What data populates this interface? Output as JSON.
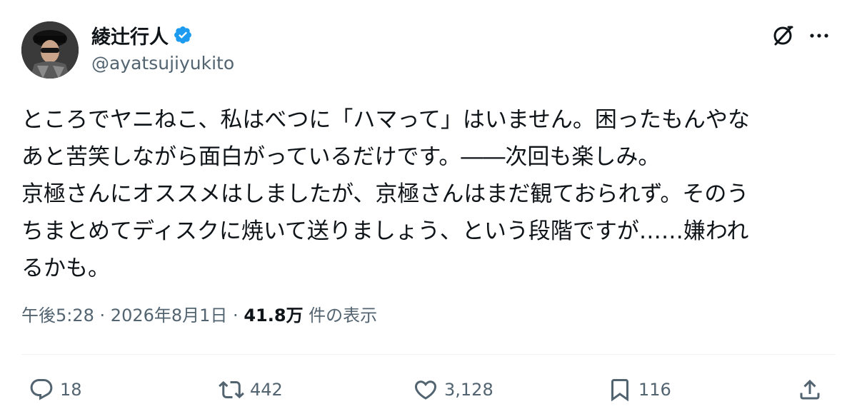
{
  "author": {
    "display_name": "綾辻行人",
    "handle": "@ayatsujiyukito",
    "verified_color": "#1d9bf0"
  },
  "tweet": {
    "lines": [
      "ところでヤニねこ、私はべつに「ハマって」はいません。困ったもんやな",
      "あと苦笑しながら面白がっているだけです。――次回も楽しみ。",
      "京極さんにオススメはしましたが、京極さんはまだ観ておられず。そのう",
      "ちまとめてディスクに焼いて送りましょう、という段階ですが……嫌われ",
      "るかも。"
    ]
  },
  "meta": {
    "time": "午後5:28",
    "separator": " · ",
    "date": "2026年8月1日",
    "views_count": "41.8万",
    "views_label": " 件の表示"
  },
  "actions": {
    "reply_count": "18",
    "retweet_count": "442",
    "like_count": "3,128",
    "bookmark_count": "116"
  },
  "icons": {
    "grok": "grok-icon",
    "more": "more-horizontal-icon",
    "reply": "reply-icon",
    "retweet": "retweet-icon",
    "like": "heart-icon",
    "bookmark": "bookmark-icon",
    "share": "share-icon"
  }
}
